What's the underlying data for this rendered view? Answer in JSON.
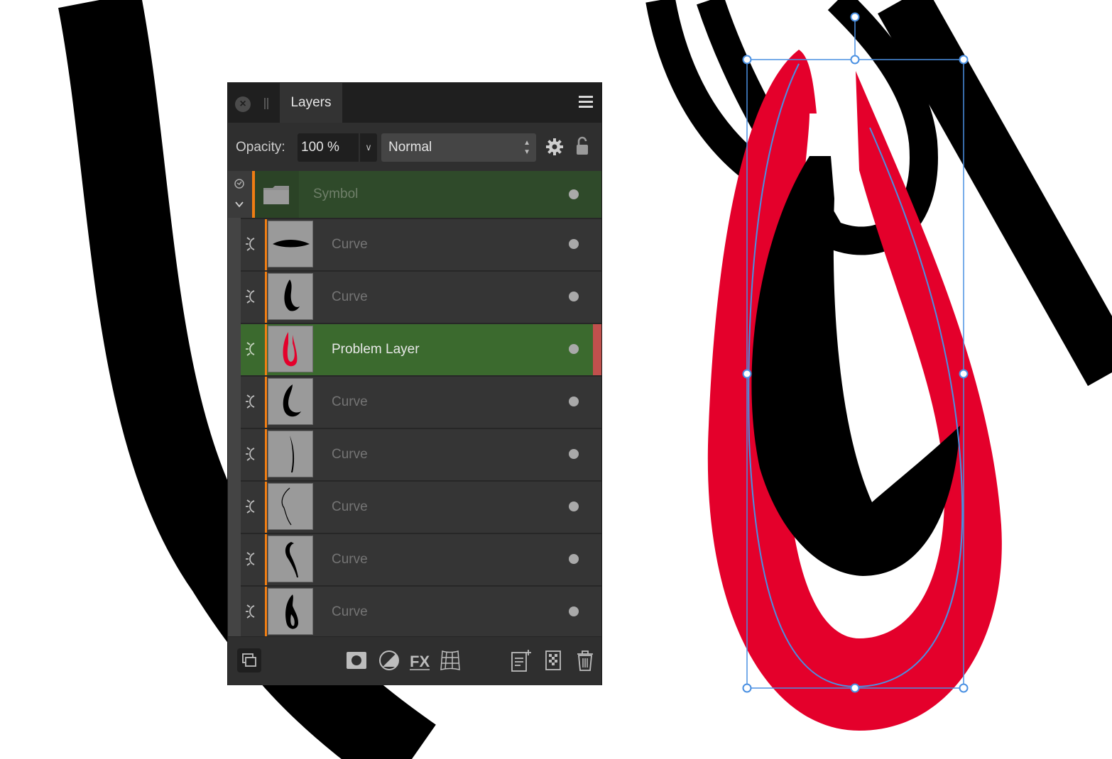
{
  "panel": {
    "tab_label": "Layers",
    "opacity_label": "Opacity:",
    "opacity_value": "100 %",
    "blend_mode": "Normal"
  },
  "layers": {
    "group": {
      "name": "Symbol"
    },
    "items": [
      {
        "name": "Curve",
        "selected": false
      },
      {
        "name": "Curve",
        "selected": false
      },
      {
        "name": "Problem Layer",
        "selected": true
      },
      {
        "name": "Curve",
        "selected": false
      },
      {
        "name": "Curve",
        "selected": false
      },
      {
        "name": "Curve",
        "selected": false
      },
      {
        "name": "Curve",
        "selected": false
      },
      {
        "name": "Curve",
        "selected": false
      }
    ]
  },
  "icons": {
    "close": "close-icon",
    "menu": "hamburger-icon",
    "settings": "gear-icon",
    "lock": "lock-icon",
    "layer_type": "vector-curve-icon",
    "bottom_toolbar": [
      "arrange-icon",
      "mask-icon",
      "adjustment-icon",
      "fx-icon",
      "mesh-warp-icon",
      "add-layer-icon",
      "add-pixel-layer-icon",
      "trash-icon"
    ]
  },
  "colors": {
    "selected_row": "#3b6a2e",
    "group_row": "#2f4a2a",
    "accent_orange": "#f07e13",
    "shape_red": "#e4002b",
    "selection_blue": "#4a90e2"
  }
}
